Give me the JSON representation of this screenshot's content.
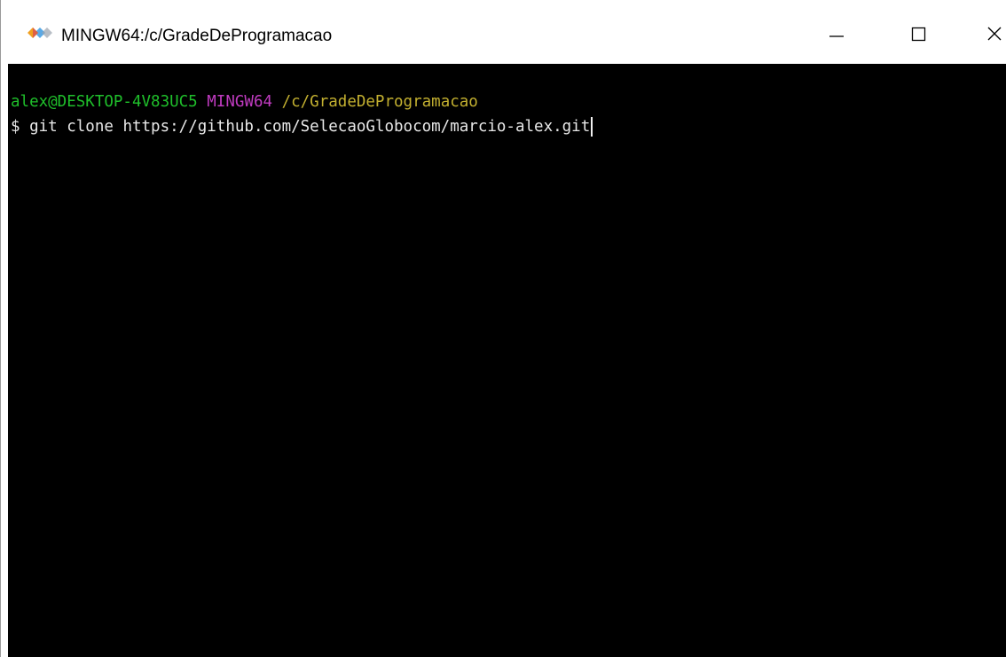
{
  "window": {
    "title": "MINGW64:/c/GradeDeProgramacao",
    "icon": "git-bash-diamond-icon",
    "controls": {
      "minimize": "minimize-icon",
      "maximize": "maximize-icon",
      "close": "close-icon"
    }
  },
  "terminal": {
    "prompt": {
      "user_host": "alex@DESKTOP-4V83UC5",
      "system": "MINGW64",
      "path": "/c/GradeDeProgramacao"
    },
    "input_line": {
      "symbol": "$",
      "command": "git clone https://github.com/SelecaoGlobocom/marcio-alex.git"
    }
  },
  "colors": {
    "terminal_background": "#000000",
    "user_host": "#1fbf2b",
    "system": "#c03bc0",
    "path": "#c3b030",
    "command": "#e8e8e8"
  }
}
